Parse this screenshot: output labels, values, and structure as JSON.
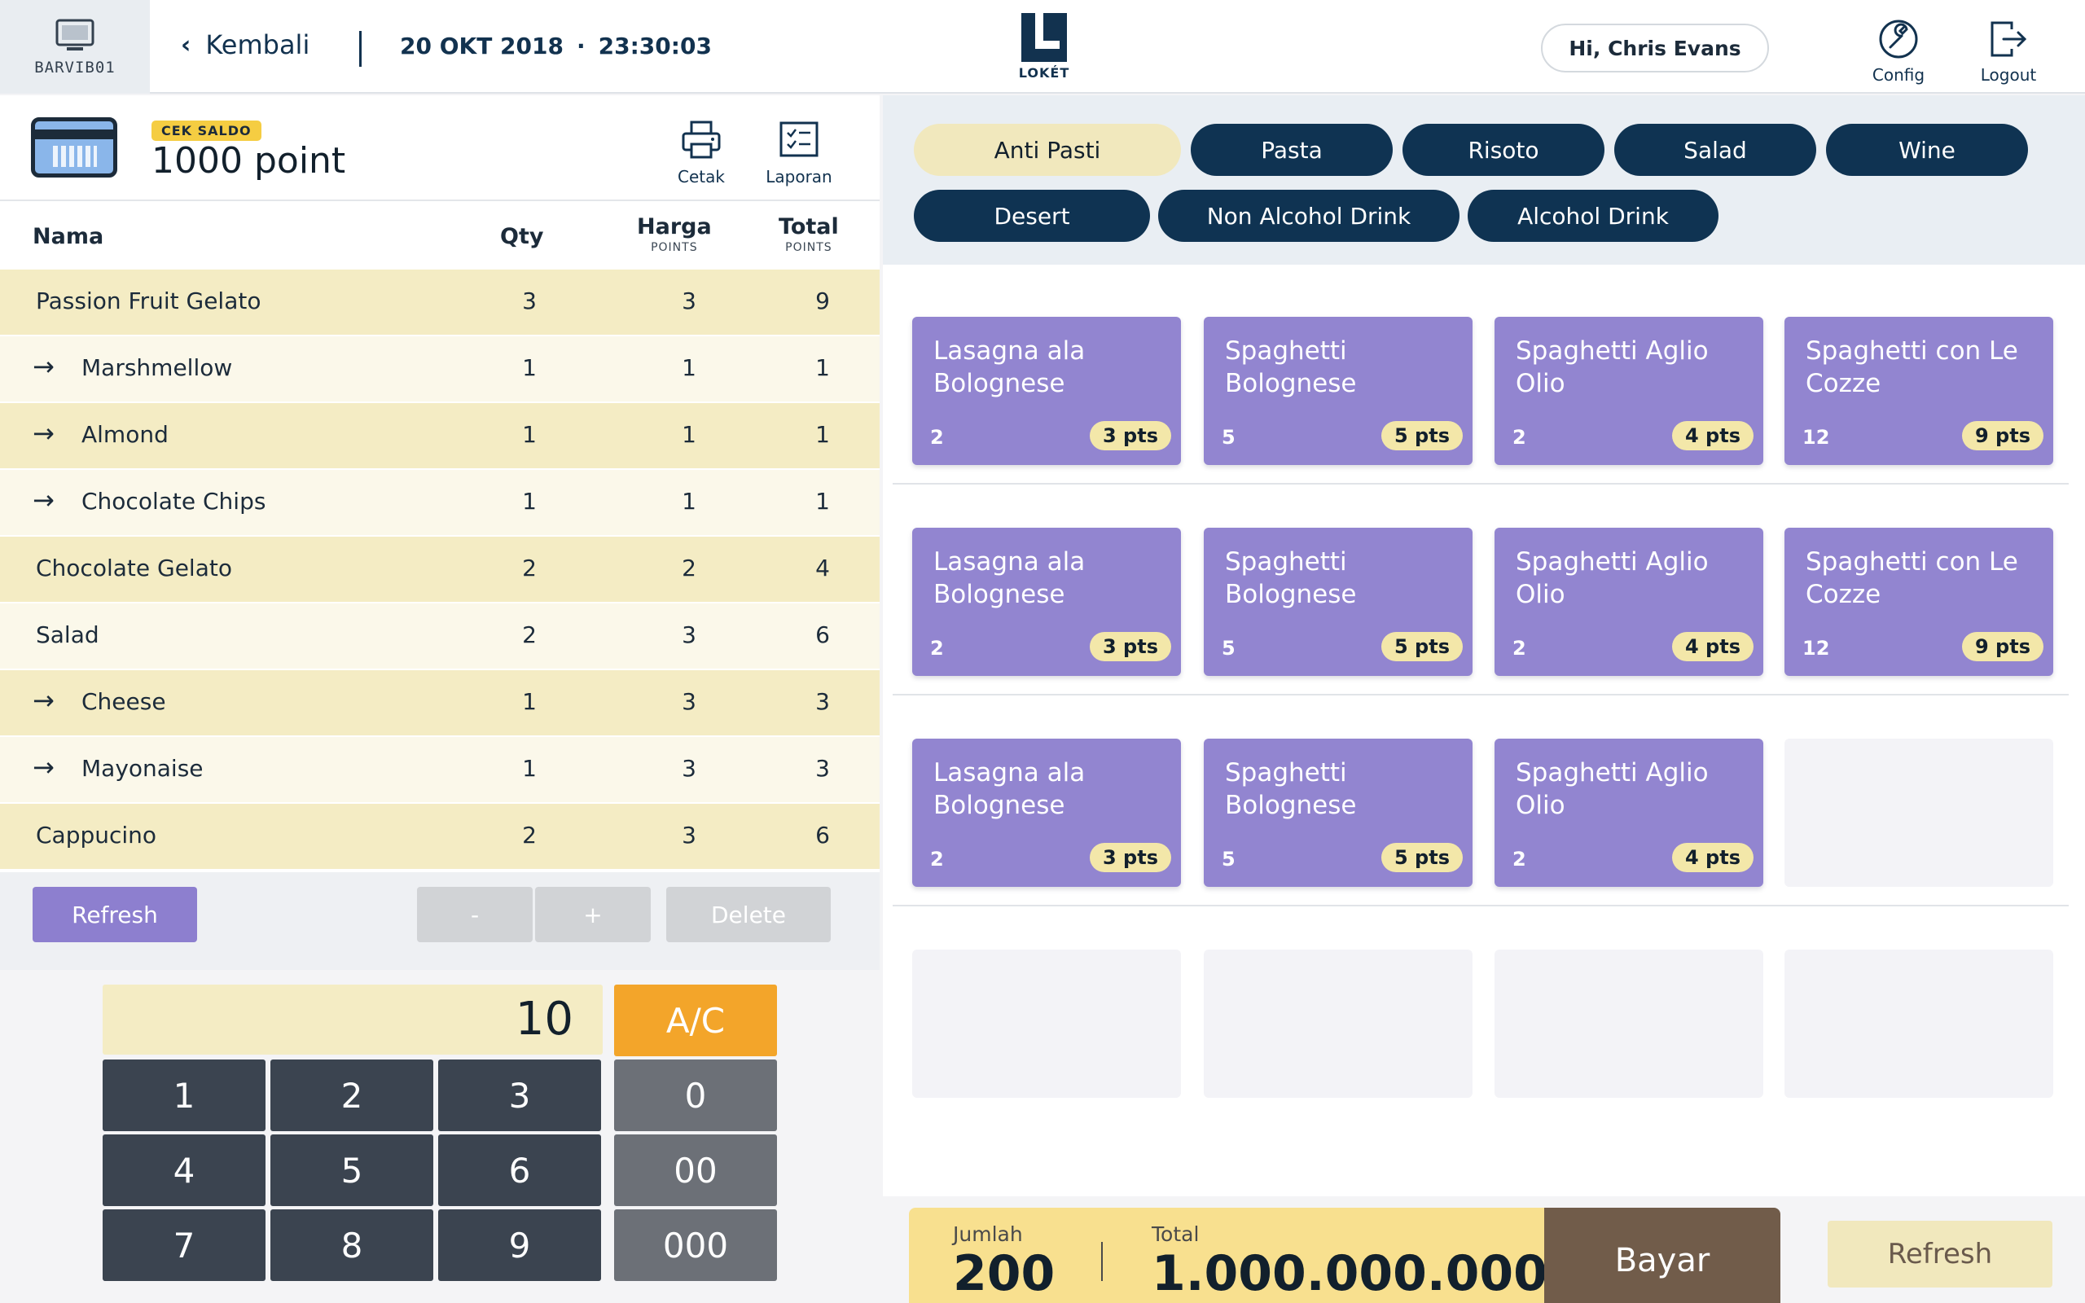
{
  "header": {
    "device_id": "BARVIB01",
    "back_label": "Kembali",
    "date": "20 OKT 2018",
    "separator": "·",
    "time": "23:30:03",
    "brand": "LOKÉT",
    "greeting": "Hi, Chris Evans",
    "config_label": "Config",
    "logout_label": "Logout"
  },
  "saldo": {
    "badge": "CEK SALDO",
    "value": "1000 point",
    "print_label": "Cetak",
    "report_label": "Laporan"
  },
  "order_table": {
    "columns": {
      "name": "Nama",
      "qty": "Qty",
      "price": "Harga",
      "total": "Total",
      "unit": "POINTS"
    },
    "rows": [
      {
        "name": "Passion Fruit Gelato",
        "qty": "3",
        "price": "3",
        "total": "9",
        "child": false
      },
      {
        "name": "Marshmellow",
        "qty": "1",
        "price": "1",
        "total": "1",
        "child": true
      },
      {
        "name": "Almond",
        "qty": "1",
        "price": "1",
        "total": "1",
        "child": true
      },
      {
        "name": "Chocolate Chips",
        "qty": "1",
        "price": "1",
        "total": "1",
        "child": true
      },
      {
        "name": "Chocolate Gelato",
        "qty": "2",
        "price": "2",
        "total": "4",
        "child": false
      },
      {
        "name": "Salad",
        "qty": "2",
        "price": "3",
        "total": "6",
        "child": false
      },
      {
        "name": "Cheese",
        "qty": "1",
        "price": "3",
        "total": "3",
        "child": true
      },
      {
        "name": "Mayonaise",
        "qty": "1",
        "price": "3",
        "total": "3",
        "child": true
      },
      {
        "name": "Cappucino",
        "qty": "2",
        "price": "3",
        "total": "6",
        "child": false
      }
    ]
  },
  "order_actions": {
    "refresh": "Refresh",
    "minus": "-",
    "plus": "+",
    "delete": "Delete"
  },
  "keypad": {
    "display": "10",
    "clear": "A/C",
    "digits": [
      "1",
      "2",
      "3",
      "4",
      "5",
      "6",
      "7",
      "8",
      "9"
    ],
    "zeros": [
      "0",
      "00",
      "000"
    ]
  },
  "categories": [
    {
      "label": "Anti Pasti",
      "active": true
    },
    {
      "label": "Pasta",
      "active": false
    },
    {
      "label": "Risoto",
      "active": false
    },
    {
      "label": "Salad",
      "active": false
    },
    {
      "label": "Wine",
      "active": false
    },
    {
      "label": "Desert",
      "active": false
    },
    {
      "label": "Non Alcohol Drink",
      "active": false
    },
    {
      "label": "Alcohol Drink",
      "active": false
    }
  ],
  "menu_items": [
    {
      "name": "Lasagna ala Bolognese",
      "qty": "2",
      "pts": "3 pts"
    },
    {
      "name": "Spaghetti Bolognese",
      "qty": "5",
      "pts": "5 pts"
    },
    {
      "name": "Spaghetti Aglio Olio",
      "qty": "2",
      "pts": "4 pts"
    },
    {
      "name": "Spaghetti con Le Cozze",
      "qty": "12",
      "pts": "9 pts"
    },
    {
      "name": "Lasagna ala Bolognese",
      "qty": "2",
      "pts": "3 pts"
    },
    {
      "name": "Spaghetti Bolognese",
      "qty": "5",
      "pts": "5 pts"
    },
    {
      "name": "Spaghetti Aglio Olio",
      "qty": "2",
      "pts": "4 pts"
    },
    {
      "name": "Spaghetti con Le Cozze",
      "qty": "12",
      "pts": "9 pts"
    },
    {
      "name": "Lasagna ala Bolognese",
      "qty": "2",
      "pts": "3 pts"
    },
    {
      "name": "Spaghetti Bolognese",
      "qty": "5",
      "pts": "5 pts"
    },
    {
      "name": "Spaghetti Aglio Olio",
      "qty": "2",
      "pts": "4 pts"
    }
  ],
  "summary": {
    "count_label": "Jumlah",
    "count_value": "200",
    "total_label": "Total",
    "total_value": "1.000.000.000",
    "pay_label": "Bayar",
    "refresh_label": "Refresh"
  },
  "colors": {
    "navy": "#0f3352",
    "tile_purple": "#9285d0",
    "row_cream": "#f4ecc4",
    "accent_orange": "#f3a52a",
    "pay_brown": "#715c4a"
  },
  "icons": [
    "monitor-icon",
    "chevron-left-icon",
    "logo-icon",
    "wrench-icon",
    "logout-icon",
    "card-icon",
    "printer-icon",
    "report-icon",
    "arrow-right-icon"
  ]
}
